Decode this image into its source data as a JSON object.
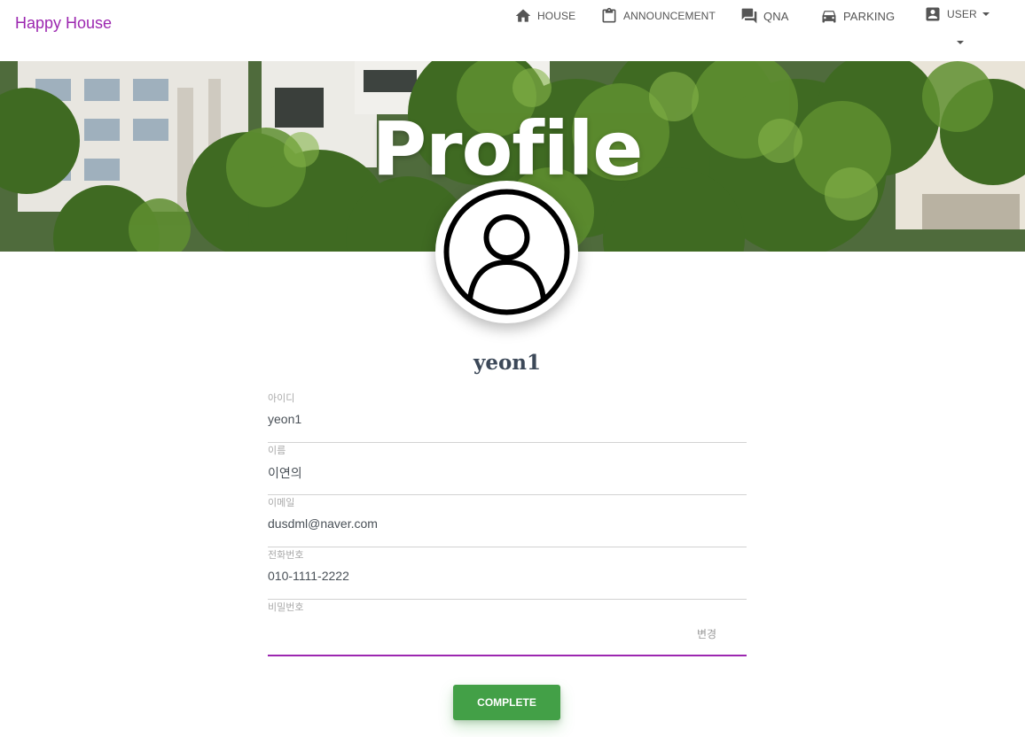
{
  "brand": "Happy House",
  "nav": {
    "house": "HOUSE",
    "announcement": "ANNOUNCEMENT",
    "qna": "QNA",
    "parking": "PARKING",
    "user": "USER"
  },
  "hero": {
    "title": "Profile"
  },
  "profile": {
    "username": "yeon1",
    "fields": {
      "id": {
        "label": "아이디",
        "value": "yeon1"
      },
      "name": {
        "label": "이름",
        "value": "이연의"
      },
      "email": {
        "label": "이메일",
        "value": "dusdml@naver.com"
      },
      "phone": {
        "label": "전화번호",
        "value": "010-1111-2222"
      },
      "password": {
        "label": "비밀번호",
        "value": "",
        "change": "변경"
      }
    },
    "complete_label": "COMPLETE"
  },
  "colors": {
    "brand": "#9c27b0",
    "accent_underline": "#9c27b0",
    "complete_button": "#43a047"
  },
  "icons": [
    "home-icon",
    "clipboard-icon",
    "chat-icon",
    "car-icon",
    "account-box-icon",
    "user-avatar-icon"
  ]
}
